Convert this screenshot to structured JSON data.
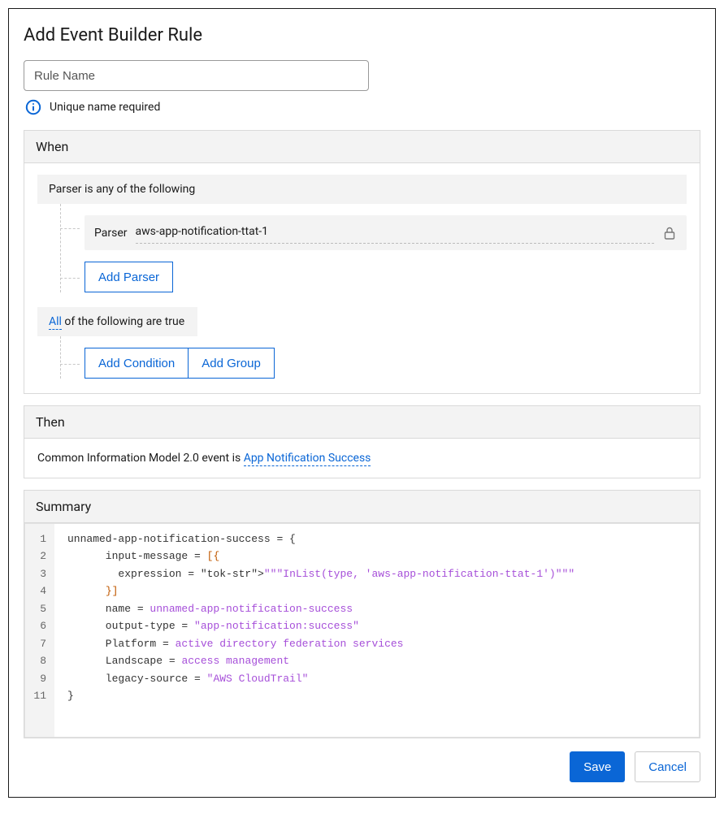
{
  "page_title": "Add Event Builder Rule",
  "rule_name": {
    "placeholder": "Rule Name",
    "value": ""
  },
  "hint": "Unique name required",
  "sections": {
    "when": {
      "header": "When",
      "parser_group_label": "Parser is any of the following",
      "parser_label": "Parser",
      "parser_value": "aws-app-notification-ttat-1",
      "add_parser_label": "Add Parser",
      "all_toggle_label": "All",
      "all_suffix": " of the following are true",
      "add_condition_label": "Add Condition",
      "add_group_label": "Add Group"
    },
    "then": {
      "header": "Then",
      "prefix": "Common Information Model 2.0 event is  ",
      "link": "App Notification Success"
    },
    "summary": {
      "header": "Summary",
      "line_numbers": [
        "1",
        "2",
        "3",
        "4",
        "5",
        "6",
        "7",
        "8",
        "9",
        "11"
      ],
      "code_plain": "unnamed-app-notification-success = {\n      input-message = [{\n        expression = \"\"\"InList(type, 'aws-app-notification-ttat-1')\"\"\"\n      }]\n      name = unnamed-app-notification-success\n      output-type = \"app-notification:success\"\n      Platform = active directory federation services\n      Landscape = access management\n      legacy-source = \"AWS CloudTrail\"\n}"
    }
  },
  "actions": {
    "save": "Save",
    "cancel": "Cancel"
  }
}
